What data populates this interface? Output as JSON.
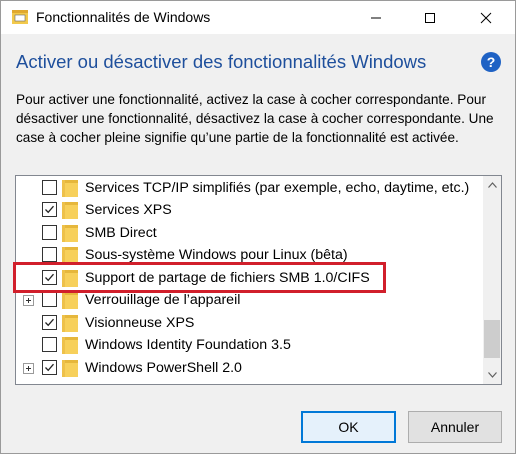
{
  "window": {
    "title": "Fonctionnalités de Windows",
    "minimize_label": "—",
    "maximize_label": "☐",
    "close_label": "✕"
  },
  "header": {
    "title": "Activer ou désactiver des fonctionnalités Windows",
    "help_label": "?"
  },
  "description": "Pour activer une fonctionnalité, activez la case à cocher correspondante. Pour désactiver une fonctionnalité, désactivez la case à cocher correspondante. Une case à cocher pleine signifie qu’une partie de la fonctionnalité est activée.",
  "features": [
    {
      "label": "Services TCP/IP simplifiés (par exemple, echo, daytime, etc.)",
      "checked": false,
      "expandable": false
    },
    {
      "label": "Services XPS",
      "checked": true,
      "expandable": false
    },
    {
      "label": "SMB Direct",
      "checked": false,
      "expandable": false
    },
    {
      "label": "Sous-système Windows pour Linux (bêta)",
      "checked": false,
      "expandable": false
    },
    {
      "label": "Support de partage de fichiers SMB 1.0/CIFS",
      "checked": true,
      "expandable": false
    },
    {
      "label": "Verrouillage de l’appareil",
      "checked": false,
      "expandable": true
    },
    {
      "label": "Visionneuse XPS",
      "checked": true,
      "expandable": false
    },
    {
      "label": "Windows Identity Foundation 3.5",
      "checked": false,
      "expandable": false
    },
    {
      "label": "Windows PowerShell 2.0",
      "checked": true,
      "expandable": true
    }
  ],
  "highlight_color": "#d11f2b",
  "accent_color": "#1e4f9c",
  "buttons": {
    "ok_label": "OK",
    "cancel_label": "Annuler"
  }
}
